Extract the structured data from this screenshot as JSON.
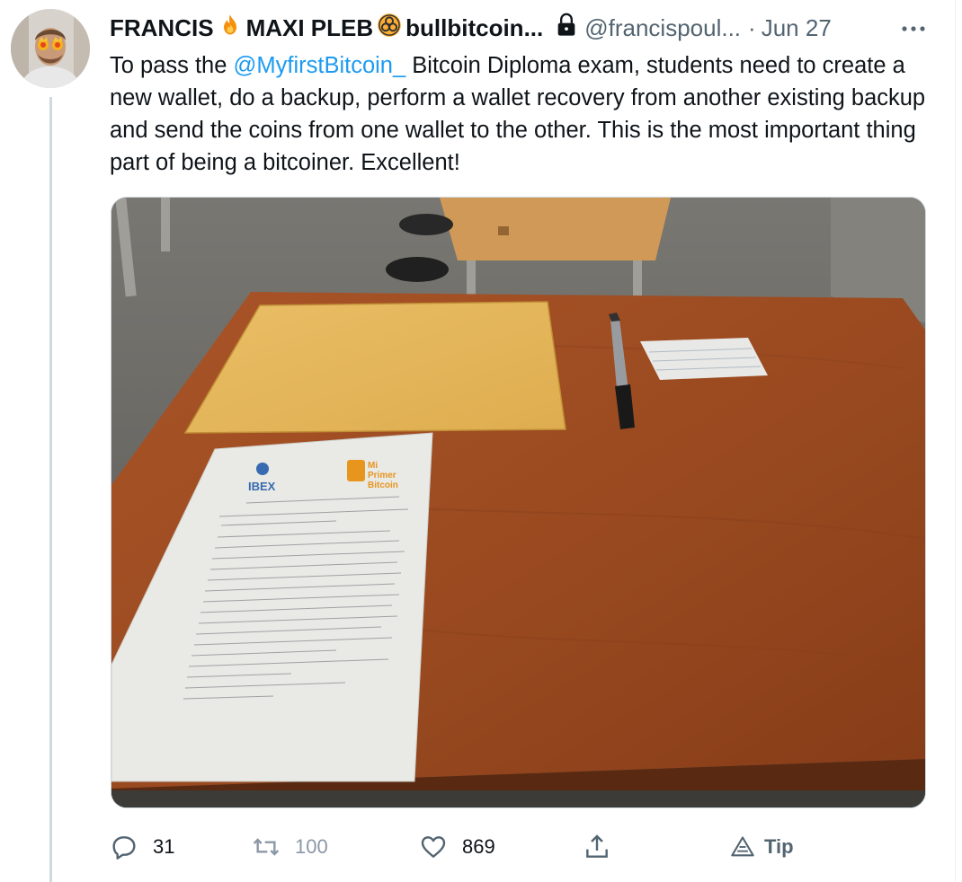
{
  "tweet": {
    "author": {
      "display_name_1": "FRANCIS",
      "display_name_2": "MAXI PLEB",
      "display_name_3": "bullbitcoin...",
      "handle": "@francispoul...",
      "date": "Jun 27"
    },
    "text": {
      "part1": "To pass the ",
      "mention": "@MyfirstBitcoin_",
      "part2": " Bitcoin Diploma exam, students need to create a new wallet, do a backup, perform a wallet recovery from another existing backup and send the coins from one wallet to the other. This is the most important thing part of being a bitcoiner. Excellent!"
    },
    "media": {
      "logo_left": "IBEX",
      "logo_right_1": "Mi",
      "logo_right_2": "Primer",
      "logo_right_3": "Bitcoin"
    },
    "actions": {
      "replies": "31",
      "retweets": "100",
      "likes": "869",
      "tip_label": "Tip"
    },
    "icons": {
      "name_emoji_1": "fire-icon",
      "name_emoji_2": "biohazard-icon",
      "lock": "lock-icon",
      "more": "more-icon",
      "reply": "reply-icon",
      "retweet": "retweet-icon",
      "like": "heart-icon",
      "share": "share-icon",
      "tip": "tip-icon"
    },
    "colors": {
      "accent": "#1d9bf0",
      "secondary_text": "#536471",
      "retweet_gray": "#8b98a5"
    }
  }
}
